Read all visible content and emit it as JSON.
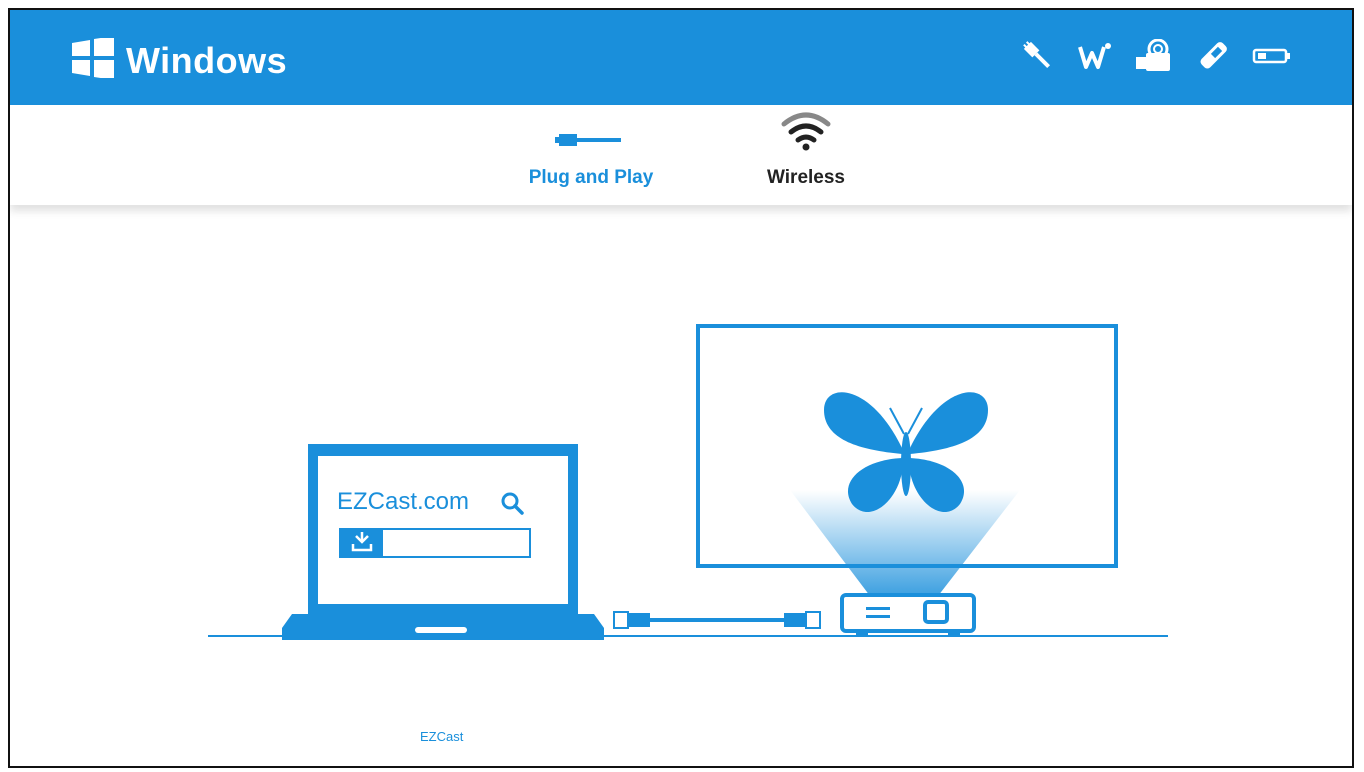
{
  "header": {
    "title": "Windows",
    "status_icons": [
      "usb-plug-icon",
      "wifi-wave-icon",
      "wireless-dongle-icon",
      "usb-stick-icon",
      "battery-icon"
    ]
  },
  "tabs": [
    {
      "label": "Plug and Play",
      "icon": "usb-cable-icon",
      "active": true
    },
    {
      "label": "Wireless",
      "icon": "wifi-icon",
      "active": false
    }
  ],
  "illustration": {
    "laptop_screen_site": "EZCast.com",
    "download_bar_label": "EZCast",
    "search_icon": "search-icon",
    "download_icon": "download-icon"
  },
  "colors": {
    "accent": "#1a8fdb",
    "text_dark": "#222222",
    "background": "#ffffff"
  }
}
